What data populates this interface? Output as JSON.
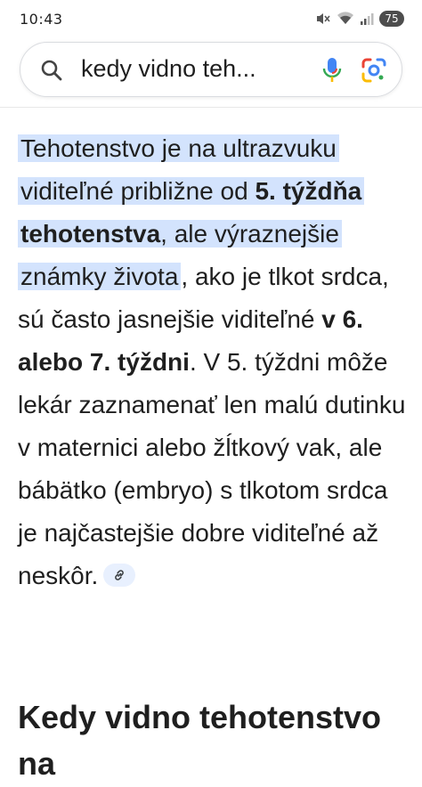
{
  "status_bar": {
    "time": "10:43",
    "battery": "75",
    "icons": [
      "mute-icon",
      "wifi-icon",
      "signal-icon",
      "battery-icon"
    ]
  },
  "search": {
    "query": "kedy vidno teh...",
    "icons": [
      "search-icon",
      "mic-icon",
      "lens-icon"
    ]
  },
  "answer": {
    "highlighted_1": "Tehotenstvo je na ultrazvuku viditeľné približne od ",
    "highlighted_bold": "5. týždňa tehotenstva",
    "highlighted_2": ", ale výraznejšie známky života",
    "text_1": ", ako je tlkot srdca, sú často jasnejšie viditeľné ",
    "bold_2": "v 6. alebo 7. týždni",
    "text_2": ". V 5. týždni môže lekár zaznamenať len malú dutinku v maternici alebo žĺtkový vak, ale bábätko (embryo) s tlkotom srdca je najčastejšie dobre viditeľné až neskôr.",
    "link_icon": "link-icon"
  },
  "heading": "Kedy vidno tehotenstvo na",
  "colors": {
    "highlight": "#d3e3fd",
    "text": "#1f1f1f",
    "chip": "#e8f0fe"
  }
}
